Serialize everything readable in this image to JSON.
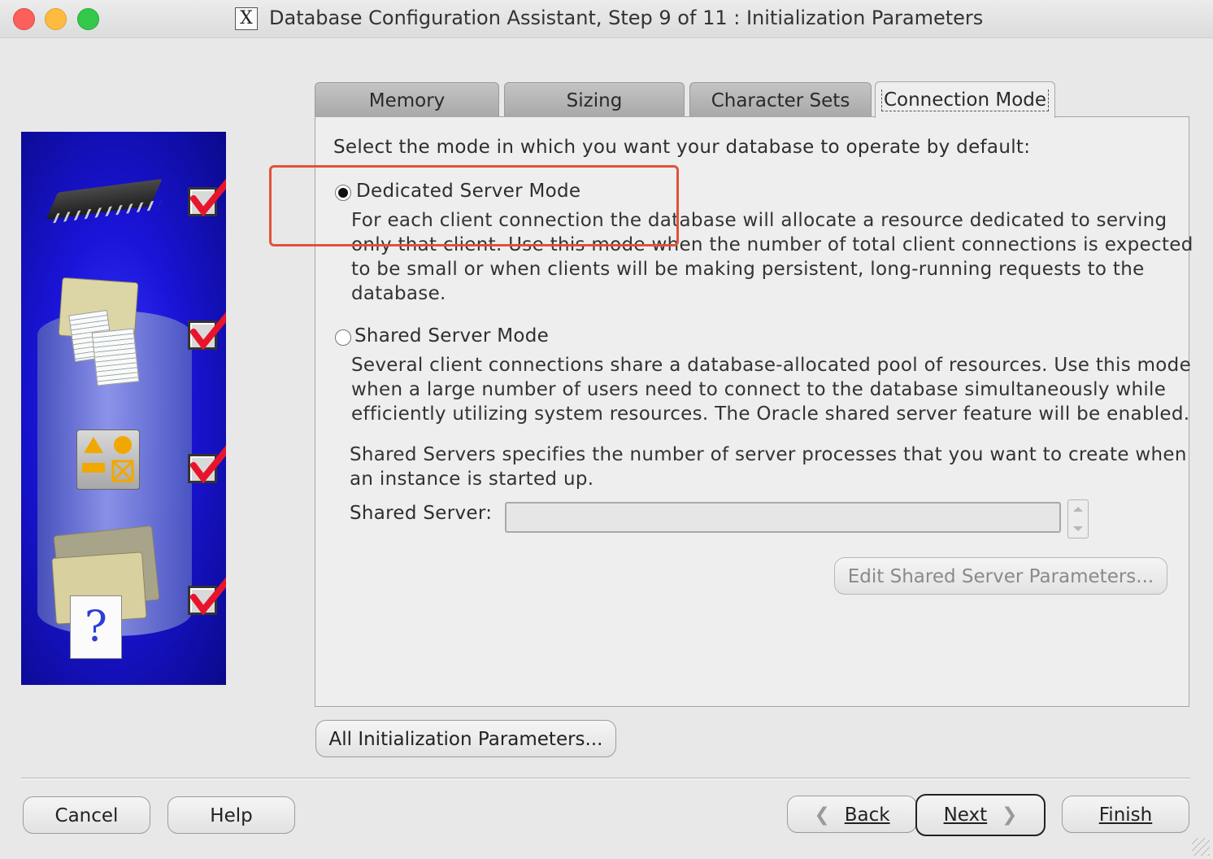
{
  "window": {
    "title": "Database Configuration Assistant, Step 9 of 11 : Initialization Parameters",
    "app_icon_glyph": "X"
  },
  "tabs": [
    {
      "label": "Memory",
      "active": false
    },
    {
      "label": "Sizing",
      "active": false
    },
    {
      "label": "Character Sets",
      "active": false
    },
    {
      "label": "Connection Mode",
      "active": true
    }
  ],
  "connection_mode": {
    "prompt": "Select the mode in which you want your database to operate by default:",
    "dedicated": {
      "label": "Dedicated Server Mode",
      "selected": true,
      "description": [
        "For each client connection the database will allocate a resource dedicated to serving",
        "only that client.  Use this mode when the number of total client connections is expected",
        "to be small or when clients will be making persistent, long-running requests to the",
        "database."
      ]
    },
    "shared": {
      "label": "Shared Server Mode",
      "selected": false,
      "description": [
        "Several client connections share a database-allocated pool of resources.  Use this mode",
        "when a large number of users need to connect to the database simultaneously while",
        "efficiently utilizing system resources.  The Oracle shared server feature will be enabled."
      ],
      "servers_note": [
        "Shared Servers specifies the number of server processes that you want to create when",
        "an instance is started up."
      ],
      "field_label": "Shared Server:",
      "field_value": "",
      "edit_button": "Edit Shared Server Parameters..."
    }
  },
  "all_params_button": "All Initialization Parameters...",
  "footer": {
    "cancel": "Cancel",
    "help": "Help",
    "back": "Back",
    "next": "Next",
    "finish": "Finish"
  },
  "side_steps_completed": 4,
  "colors": {
    "accent_highlight": "#e0523a",
    "panel_blue": "#1a14d8",
    "check_red": "#e8142c"
  },
  "icons": [
    "chip-icon",
    "documents-icon",
    "shapes-icon",
    "help-documents-icon",
    "checkmark-icon"
  ]
}
